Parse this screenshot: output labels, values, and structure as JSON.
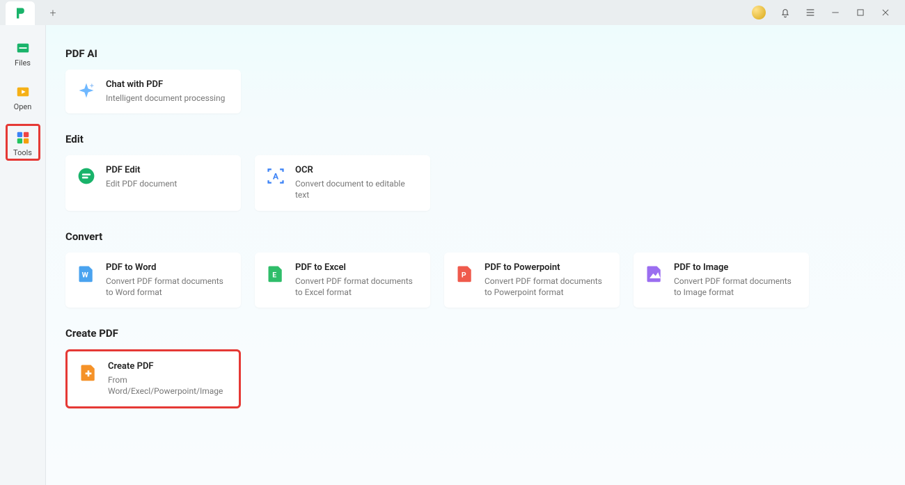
{
  "titlebar": {
    "new_tab": "+"
  },
  "sidebar": {
    "items": [
      {
        "label": "Files"
      },
      {
        "label": "Open"
      },
      {
        "label": "Tools"
      }
    ]
  },
  "sections": {
    "pdf_ai": {
      "heading": "PDF AI",
      "items": [
        {
          "title": "Chat with PDF",
          "sub": "Intelligent document processing"
        }
      ]
    },
    "edit": {
      "heading": "Edit",
      "items": [
        {
          "title": "PDF Edit",
          "sub": "Edit PDF document"
        },
        {
          "title": "OCR",
          "sub": "Convert document to editable text"
        }
      ]
    },
    "convert": {
      "heading": "Convert",
      "items": [
        {
          "title": "PDF to Word",
          "sub": "Convert PDF format documents to Word format"
        },
        {
          "title": "PDF to Excel",
          "sub": "Convert PDF format documents to Excel format"
        },
        {
          "title": "PDF to Powerpoint",
          "sub": "Convert PDF format documents to Powerpoint format"
        },
        {
          "title": "PDF to Image",
          "sub": "Convert PDF format documents to Image format"
        }
      ]
    },
    "create": {
      "heading": "Create PDF",
      "items": [
        {
          "title": "Create PDF",
          "sub": "From Word/Execl/Powerpoint/Image"
        }
      ]
    }
  }
}
